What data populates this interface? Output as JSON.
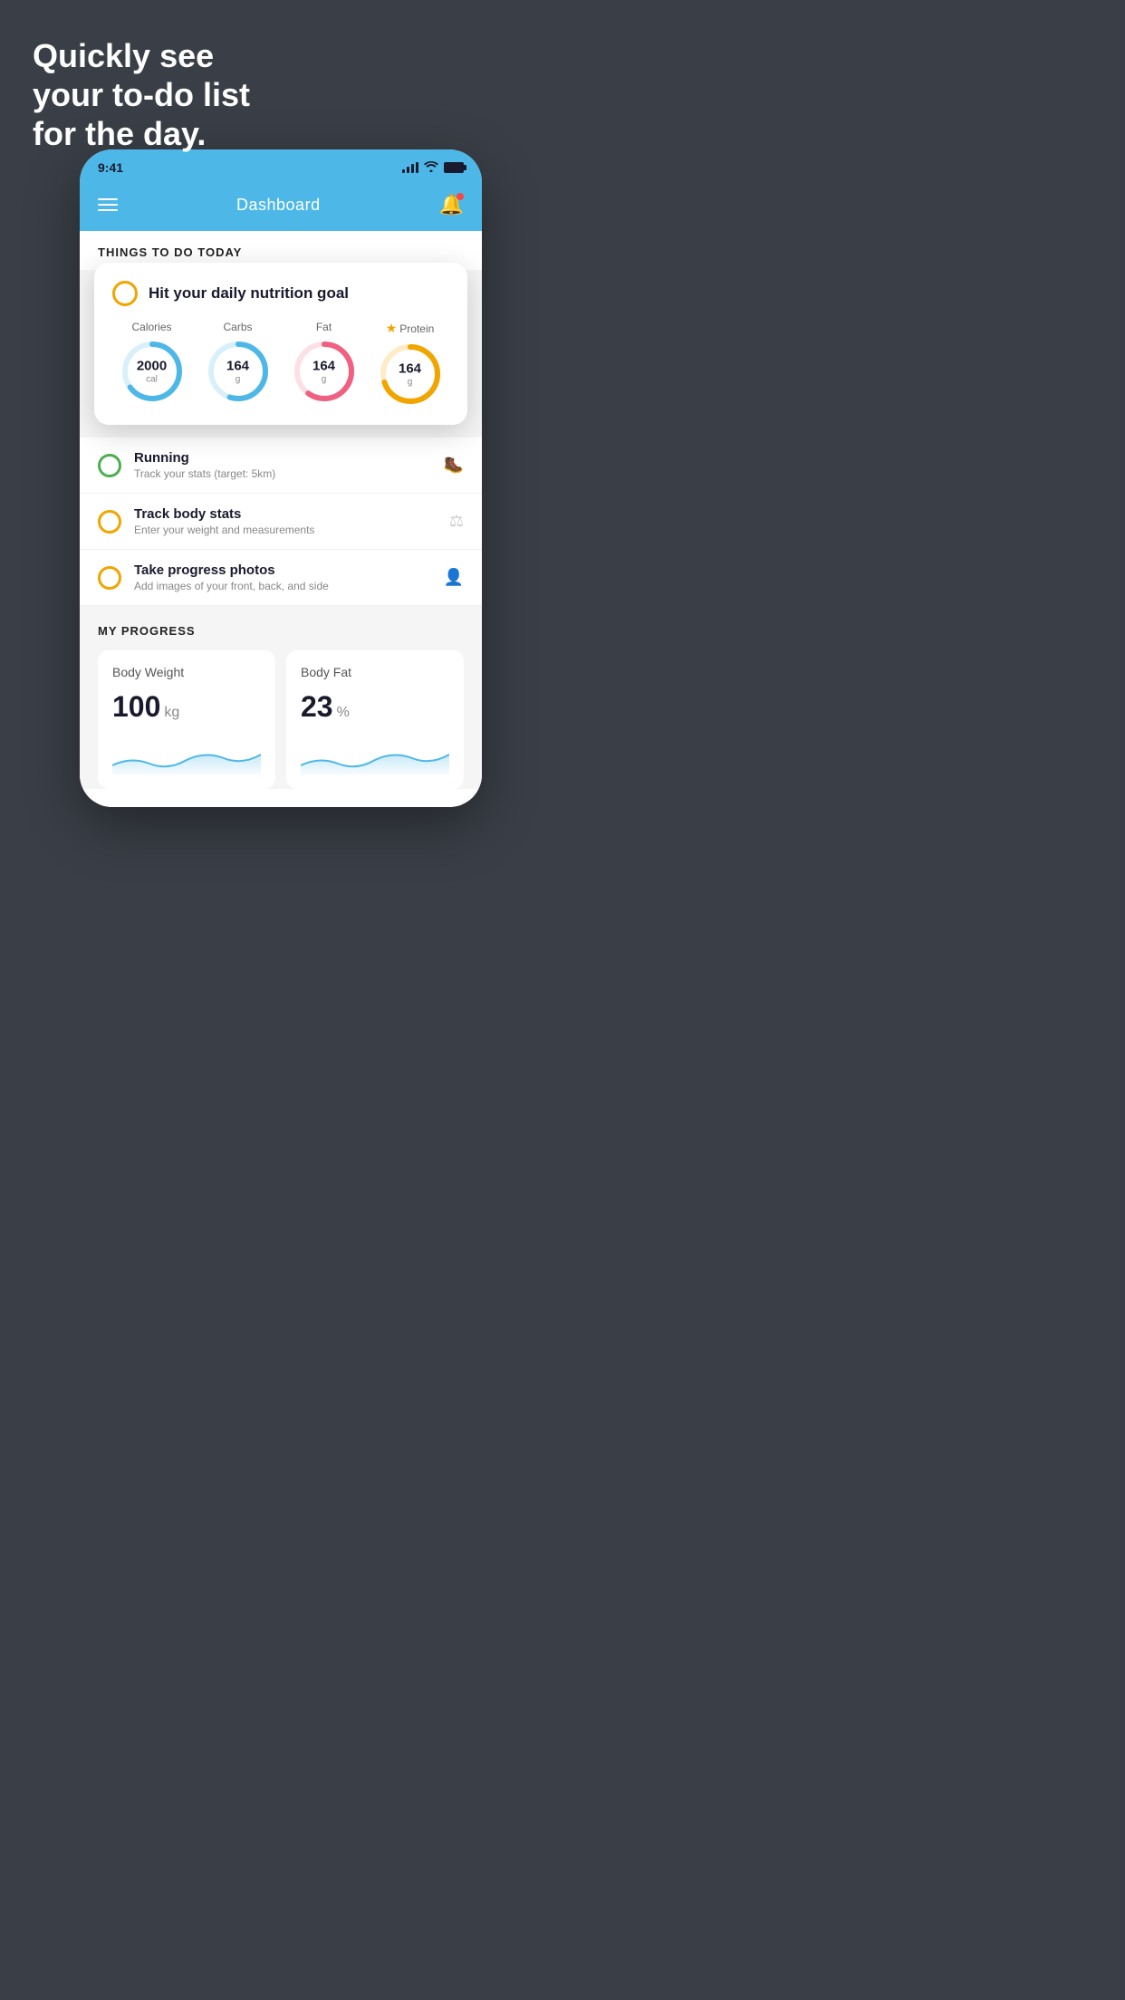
{
  "hero": {
    "line1": "Quickly see",
    "line2": "your to-do list",
    "line3": "for the day."
  },
  "statusBar": {
    "time": "9:41"
  },
  "navbar": {
    "title": "Dashboard"
  },
  "sectionHeader": "THINGS TO DO TODAY",
  "nutritionCard": {
    "title": "Hit your daily nutrition goal",
    "items": [
      {
        "label": "Calories",
        "value": "2000",
        "unit": "cal",
        "color": "#4db8e8",
        "trackColor": "#d9f0fb",
        "pct": 65,
        "star": false
      },
      {
        "label": "Carbs",
        "value": "164",
        "unit": "g",
        "color": "#4db8e8",
        "trackColor": "#d9f0fb",
        "pct": 55,
        "star": false
      },
      {
        "label": "Fat",
        "value": "164",
        "unit": "g",
        "color": "#f06080",
        "trackColor": "#fde0e6",
        "pct": 60,
        "star": false
      },
      {
        "label": "Protein",
        "value": "164",
        "unit": "g",
        "color": "#f0a500",
        "trackColor": "#fdecc5",
        "pct": 70,
        "star": true
      }
    ]
  },
  "todoItems": [
    {
      "title": "Running",
      "subtitle": "Track your stats (target: 5km)",
      "circleColor": "green",
      "icon": "🥾"
    },
    {
      "title": "Track body stats",
      "subtitle": "Enter your weight and measurements",
      "circleColor": "yellow",
      "icon": "⚖"
    },
    {
      "title": "Take progress photos",
      "subtitle": "Add images of your front, back, and side",
      "circleColor": "yellow",
      "icon": "👤"
    }
  ],
  "progressSection": {
    "title": "MY PROGRESS",
    "cards": [
      {
        "title": "Body Weight",
        "value": "100",
        "unit": "kg"
      },
      {
        "title": "Body Fat",
        "value": "23",
        "unit": "%"
      }
    ]
  }
}
